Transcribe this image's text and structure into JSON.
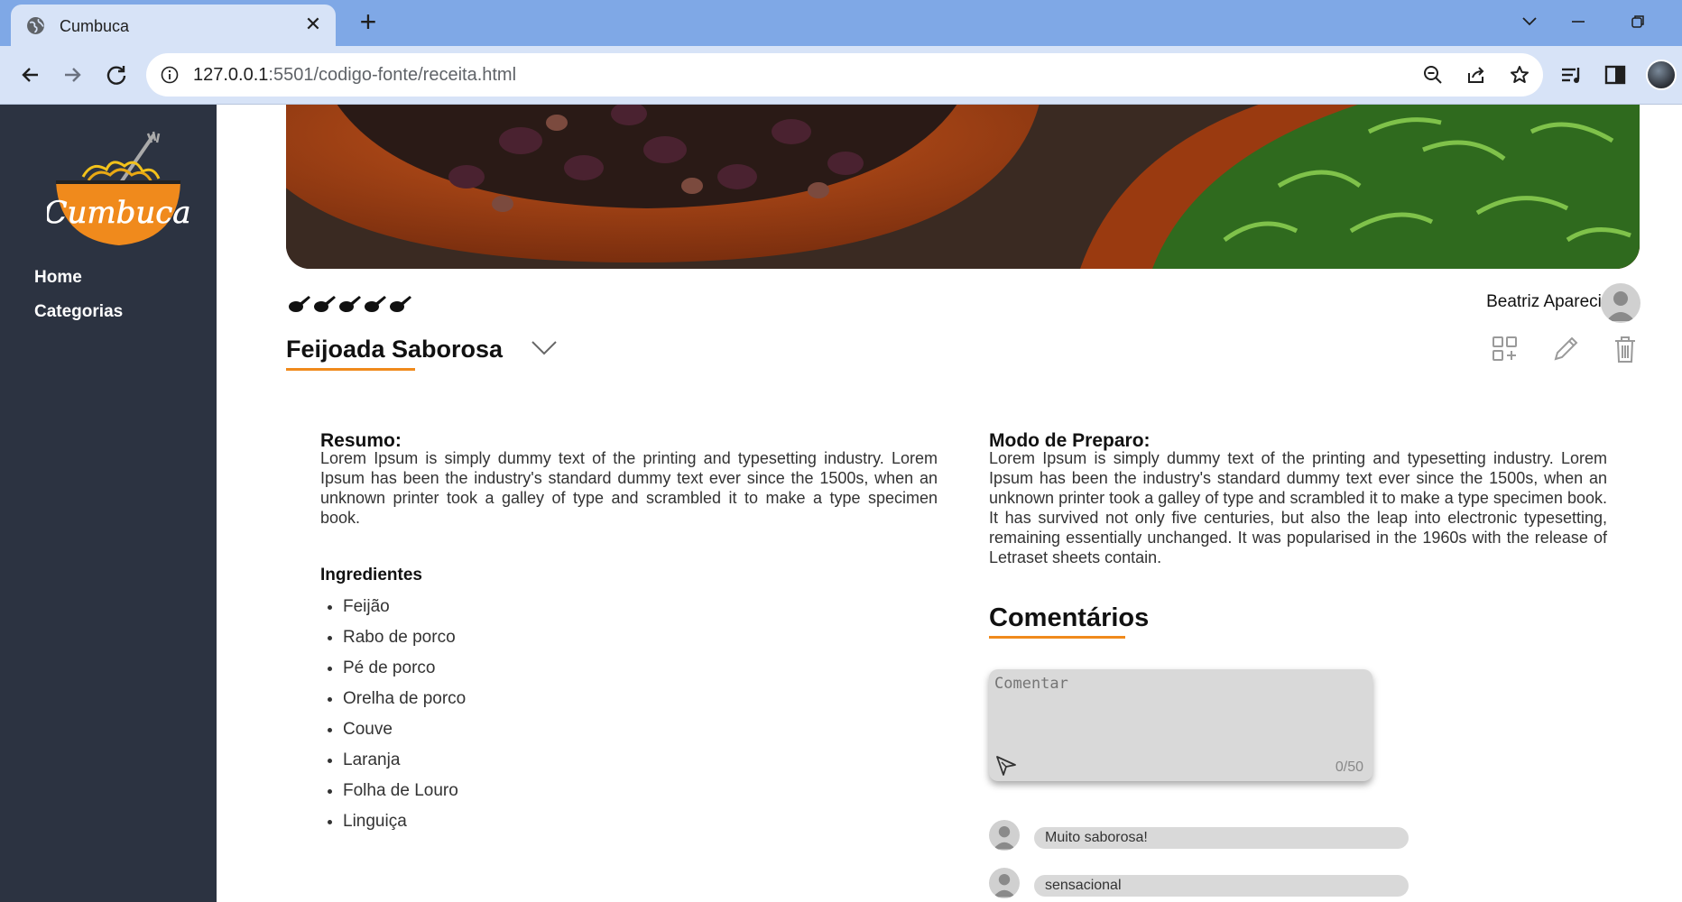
{
  "browser": {
    "tab_title": "Cumbuca",
    "url_host": "127.0.0.1",
    "url_rest": ":5501/codigo-fonte/receita.html"
  },
  "sidebar": {
    "logo_text": "Cumbuca",
    "items": [
      {
        "label": "Home"
      },
      {
        "label": "Categorias"
      }
    ]
  },
  "recipe": {
    "rating": 5,
    "author": "Beatriz Aparecida",
    "title": "Feijoada Saborosa",
    "summary_title": "Resumo:",
    "summary_text": "Lorem Ipsum is simply dummy text of the printing and typesetting industry. Lorem Ipsum has been the industry's standard dummy text ever since the 1500s, when an unknown printer took a galley of type and scrambled it to make a type specimen book.",
    "ingredients_title": "Ingredientes",
    "ingredients": [
      "Feijão",
      "Rabo de porco",
      "Pé de porco",
      "Orelha de porco",
      "Couve",
      "Laranja",
      "Folha de Louro",
      "Linguiça"
    ],
    "method_title": "Modo de Preparo:",
    "method_text": "Lorem Ipsum is simply dummy text of the printing and typesetting industry. Lorem Ipsum has been the industry's standard dummy text ever since the 1500s, when an unknown printer took a galley of type and scrambled it to make a type specimen book. It has survived not only five centuries, but also the leap into electronic typesetting, remaining essentially unchanged. It was popularised in the 1960s with the release of Letraset sheets contain."
  },
  "comments": {
    "title": "Comentários",
    "placeholder": "Comentar",
    "counter": "0/50",
    "items": [
      {
        "text": "Muito saborosa!"
      },
      {
        "text": "sensacional"
      }
    ]
  },
  "colors": {
    "accent": "#f08a1c",
    "sidebar": "#2c3341",
    "tab_strip": "#7fa8e6",
    "toolbar": "#d7e3f7"
  }
}
